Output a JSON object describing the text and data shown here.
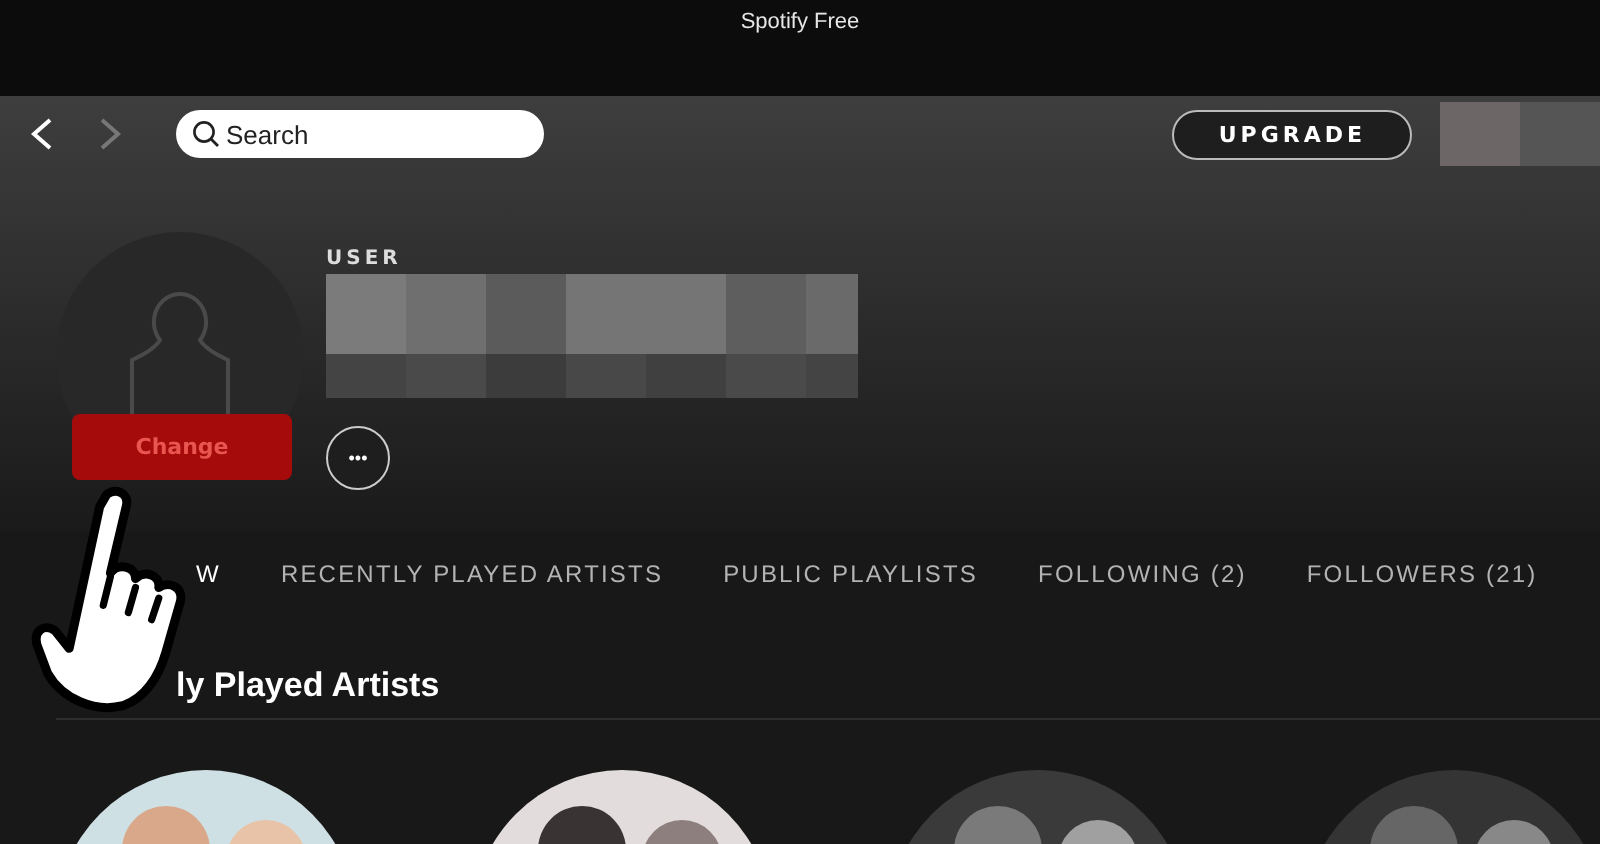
{
  "window": {
    "title": "Spotify Free"
  },
  "topbar": {
    "search": {
      "placeholder": "Search"
    },
    "upgrade_button": "UPGRADE",
    "forward_disabled": true
  },
  "profile": {
    "type_label": "USER",
    "change_button": "Change",
    "more_button": "•••"
  },
  "tabs": [
    {
      "label": "W",
      "selected": true
    },
    {
      "label": "RECENTLY PLAYED ARTISTS",
      "selected": false
    },
    {
      "label": "PUBLIC PLAYLISTS",
      "selected": false
    },
    {
      "label": "FOLLOWING (2)",
      "selected": false
    },
    {
      "label": "FOLLOWERS (21)",
      "selected": false
    }
  ],
  "section": {
    "heading": "ly Played Artists"
  }
}
